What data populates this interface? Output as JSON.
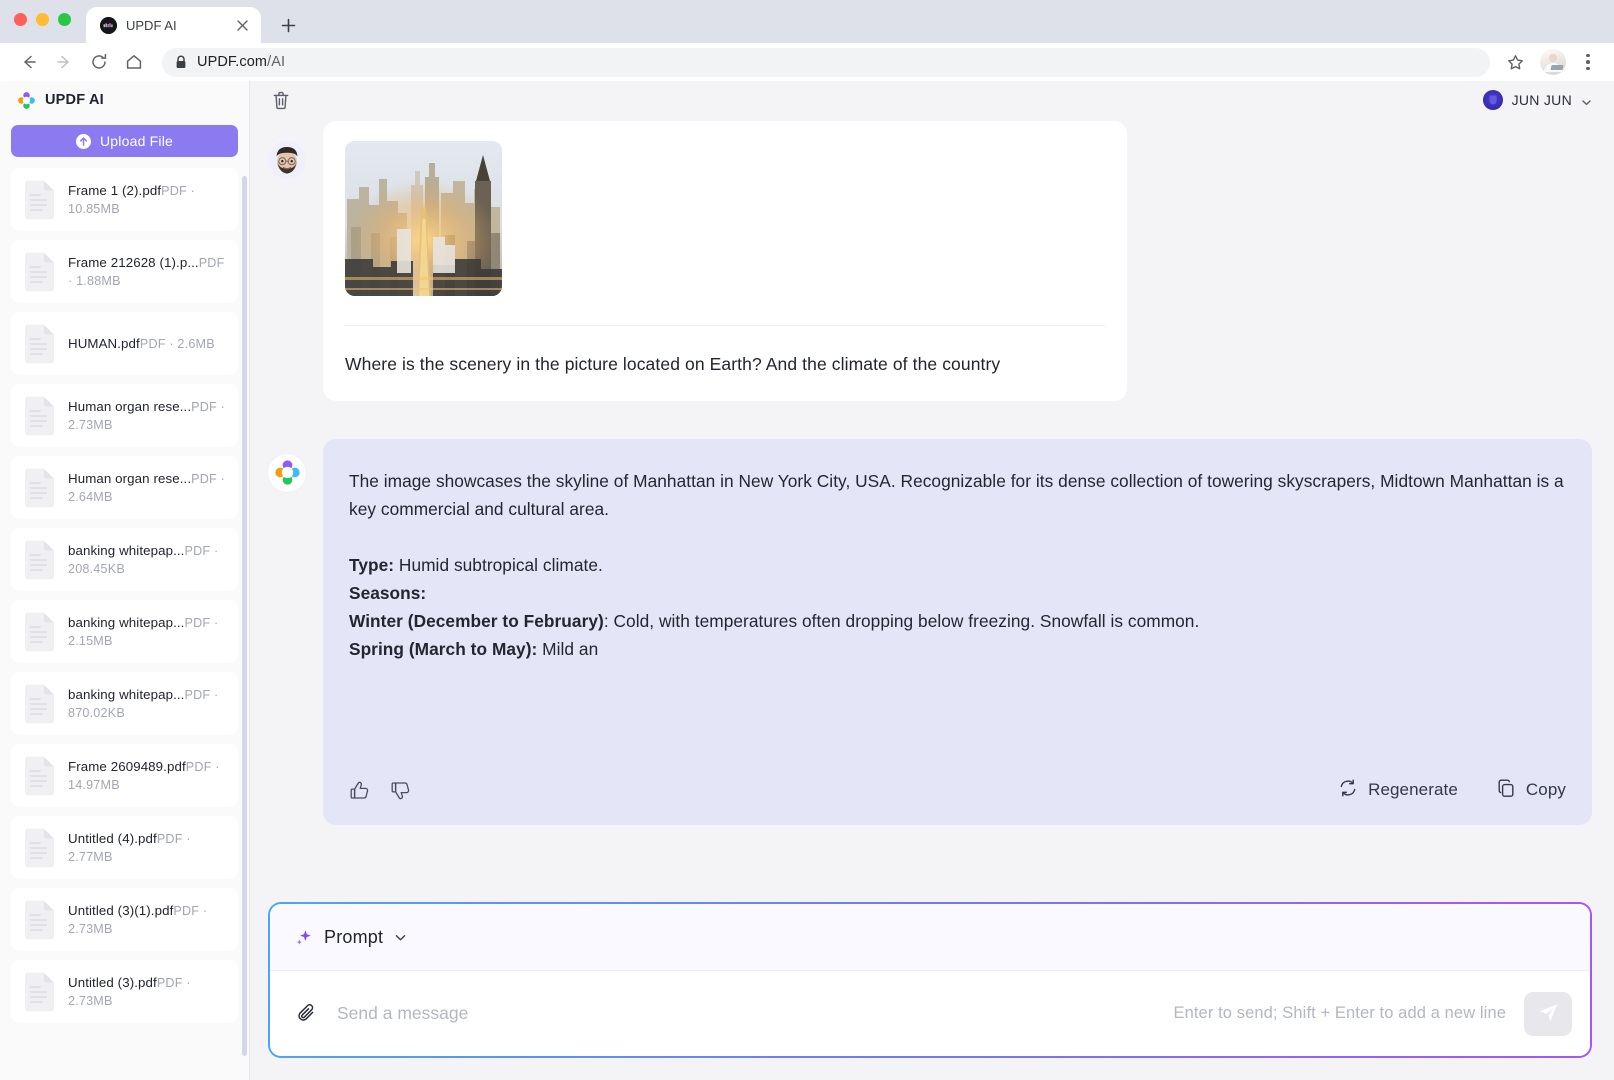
{
  "browser": {
    "tab": {
      "title": "UPDF AI",
      "favicon_icon": "updf-favicon",
      "close_icon": "close-icon"
    },
    "newtab_icon": "plus-icon",
    "nav": {
      "back_icon": "arrow-back-icon",
      "forward_icon": "arrow-forward-icon",
      "reload_icon": "reload-icon",
      "home_icon": "home-icon"
    },
    "address": {
      "lock_icon": "lock-icon",
      "url_main": "UPDF.com",
      "url_path": "/AI"
    },
    "star_icon": "star-icon",
    "profile_icon": "browser-profile-avatar",
    "menu_icon": "kebab-menu-icon"
  },
  "sidebar": {
    "brand": "UPDF AI",
    "brand_icon": "updf-logo-icon",
    "upload": {
      "label": "Upload File",
      "icon": "upload-circle-icon",
      "color": "#8c7bf0"
    },
    "files": [
      {
        "name": "Frame 1 (2).pdf",
        "meta": "PDF · 10.85MB"
      },
      {
        "name": "Frame 212628 (1).p...",
        "meta": "PDF · 1.88MB"
      },
      {
        "name": "HUMAN.pdf",
        "meta": "PDF · 2.6MB"
      },
      {
        "name": "Human organ rese...",
        "meta": "PDF · 2.73MB"
      },
      {
        "name": "Human organ rese...",
        "meta": "PDF · 2.64MB"
      },
      {
        "name": "banking whitepap...",
        "meta": "PDF · 208.45KB"
      },
      {
        "name": "banking whitepap...",
        "meta": "PDF · 2.15MB"
      },
      {
        "name": "banking whitepap...",
        "meta": "PDF · 870.02KB"
      },
      {
        "name": "Frame 2609489.pdf",
        "meta": "PDF · 14.97MB"
      },
      {
        "name": "Untitled (4).pdf",
        "meta": "PDF · 2.77MB"
      },
      {
        "name": "Untitled (3)(1).pdf",
        "meta": "PDF · 2.73MB"
      },
      {
        "name": "Untitled (3).pdf",
        "meta": "PDF · 2.73MB"
      }
    ]
  },
  "topbar": {
    "trash_icon": "trash-icon",
    "user_name": "JUN JUN",
    "user_avatar_icon": "user-avatar-icon",
    "chevron_icon": "chevron-down-icon"
  },
  "conversation": {
    "user_message": {
      "avatar_icon": "user-memoji-avatar",
      "image_alt": "Manhattan skyline at sunset",
      "text": "Where is the scenery in the picture located on Earth? And the climate of the country"
    },
    "ai_message": {
      "avatar_icon": "updf-ai-logo-icon",
      "paragraph1": "The image showcases the skyline of Manhattan in New York City, USA. Recognizable for its dense collection of towering skyscrapers, Midtown Manhattan is a key commercial and cultural area.",
      "type_label": "Type:",
      "type_value": " Humid subtropical climate.",
      "seasons_label": "Seasons:",
      "winter_label": "Winter (December to February)",
      "winter_value": ": Cold, with temperatures often dropping below freezing. Snowfall is common.",
      "spring_label": "Spring (March to May):",
      "spring_value": " Mild an",
      "bubble_color": "#e5e5f8",
      "actions": {
        "thumbs_up_icon": "thumbs-up-icon",
        "thumbs_down_icon": "thumbs-down-icon",
        "regenerate_label": "Regenerate",
        "regenerate_icon": "refresh-icon",
        "copy_label": "Copy",
        "copy_icon": "copy-icon"
      }
    }
  },
  "composer": {
    "prompt_label": "Prompt",
    "prompt_icon": "sparkle-icon",
    "prompt_chevron_icon": "chevron-down-icon",
    "attach_icon": "paperclip-icon",
    "input_value": "",
    "input_placeholder": "Send a message",
    "hint": "Enter to send; Shift + Enter to add a new line",
    "send_icon": "send-paper-plane-icon"
  }
}
